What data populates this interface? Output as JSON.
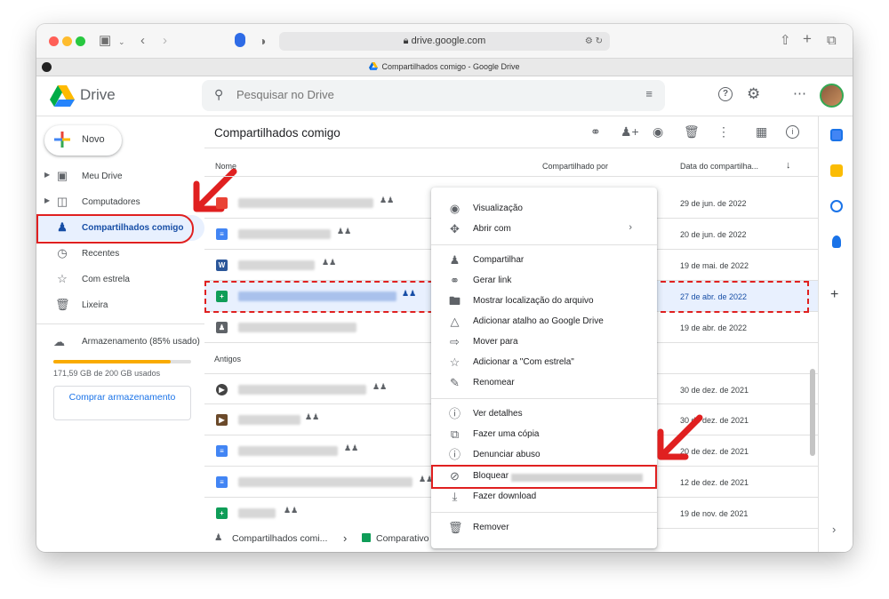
{
  "browser": {
    "url": "drive.google.com",
    "tab_title": "Compartilhados comigo - Google Drive"
  },
  "header": {
    "logo_text": "Drive",
    "search_placeholder": "Pesquisar no Drive"
  },
  "sidebar": {
    "new_label": "Novo",
    "items": [
      {
        "label": "Meu Drive",
        "icon": "my-drive-icon"
      },
      {
        "label": "Computadores",
        "icon": "computers-icon"
      },
      {
        "label": "Compartilhados comigo",
        "icon": "shared-icon"
      },
      {
        "label": "Recentes",
        "icon": "clock-icon"
      },
      {
        "label": "Com estrela",
        "icon": "star-icon"
      },
      {
        "label": "Lixeira",
        "icon": "trash-icon"
      }
    ],
    "storage_label": "Armazenamento (85% usado)",
    "storage_fraction": 0.85,
    "storage_used": "171,59 GB de 200 GB usados",
    "buy_label": "Comprar armazenamento"
  },
  "main": {
    "title": "Compartilhados comigo",
    "columns": {
      "name": "Nome",
      "shared_by": "Compartilhado por",
      "date": "Data do compartilha..."
    },
    "section_old": "Antigos",
    "rows": [
      {
        "date": "29 de jun. de 2022",
        "type": "pdf"
      },
      {
        "date": "20 de jun. de 2022",
        "type": "docs"
      },
      {
        "date": "19 de mai. de 2022",
        "type": "word"
      },
      {
        "date": "27 de abr. de 2022",
        "type": "sheets",
        "selected": true
      },
      {
        "date": "19 de abr. de 2022",
        "type": "folder"
      },
      {
        "date": "30 de dez. de 2021",
        "type": "video"
      },
      {
        "date": "30 de dez. de 2021",
        "type": "video"
      },
      {
        "date": "20 de dez. de 2021",
        "type": "docs"
      },
      {
        "date": "12 de dez. de 2021",
        "type": "docs"
      },
      {
        "date": "19 de nov. de 2021",
        "type": "sheets"
      }
    ]
  },
  "footer": {
    "crumb1": "Compartilhados comi...",
    "crumb2": "Comparativo"
  },
  "context_menu": {
    "items": [
      {
        "label": "Visualização",
        "icon": "eye-icon"
      },
      {
        "label": "Abrir com",
        "icon": "move-icon"
      },
      {
        "label": "Compartilhar",
        "icon": "person-add-icon"
      },
      {
        "label": "Gerar link",
        "icon": "link-icon"
      },
      {
        "label": "Mostrar localização do arquivo",
        "icon": "folder-icon"
      },
      {
        "label": "Adicionar atalho ao Google Drive",
        "icon": "add-shortcut-icon"
      },
      {
        "label": "Mover para",
        "icon": "move-to-icon"
      },
      {
        "label": "Adicionar a \"Com estrela\"",
        "icon": "star-icon"
      },
      {
        "label": "Renomear",
        "icon": "edit-icon"
      },
      {
        "label": "Ver detalhes",
        "icon": "info-icon"
      },
      {
        "label": "Fazer uma cópia",
        "icon": "copy-icon"
      },
      {
        "label": "Denunciar abuso",
        "icon": "report-icon"
      },
      {
        "label": "Bloquear",
        "icon": "block-icon"
      },
      {
        "label": "Fazer download",
        "icon": "download-icon"
      },
      {
        "label": "Remover",
        "icon": "trash-icon"
      }
    ]
  },
  "colors": {
    "highlight_red": "#e02020",
    "selected_bg": "#e8f0fe",
    "accent_blue": "#1a73e8"
  }
}
